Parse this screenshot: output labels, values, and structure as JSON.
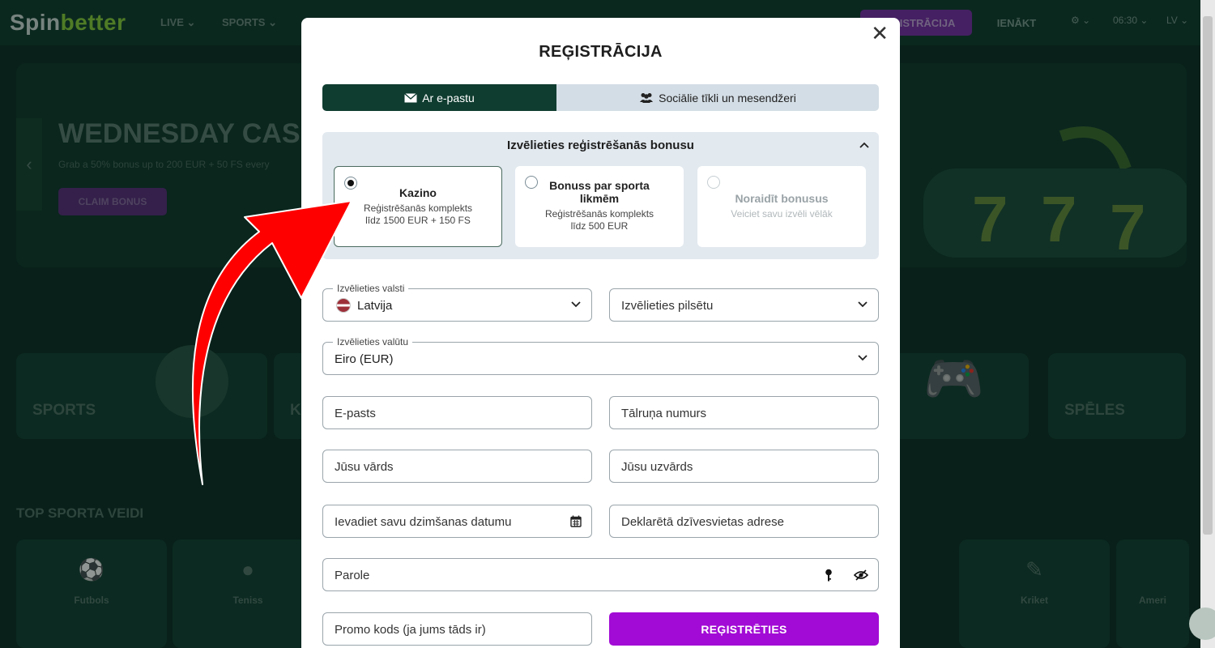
{
  "background": {
    "logo_a": "Spin",
    "logo_b": "better",
    "nav": [
      "LIVE ⌄",
      "SPORTS ⌄"
    ],
    "register_label": "REĢISTRĀCIJA",
    "login_label": "IENĀKT",
    "time": "06:30 ⌄",
    "lang": "LV ⌄",
    "banner_title": "WEDNESDAY CASI",
    "banner_sub": "Grab a 50% bonus up to 200 EUR + 50 FS every",
    "banner_btn": "CLAIM BONUS",
    "categories": [
      {
        "label": "SPORTS"
      },
      {
        "label": "K"
      },
      {
        "label": "SPĒLES"
      }
    ],
    "section_title": "TOP SPORTA VEIDI",
    "sports": [
      {
        "label": "Futbols",
        "icon": "⚽"
      },
      {
        "label": "Teniss",
        "icon": "●"
      },
      {
        "label": "Kriket",
        "icon": "✎"
      },
      {
        "label": "Kriket",
        "icon": "⚾"
      },
      {
        "label": "Ameri",
        "icon": "◎"
      }
    ]
  },
  "modal": {
    "title": "REĢISTRĀCIJA",
    "close": "✕",
    "tabs": [
      {
        "label": "Ar e-pastu",
        "icon": "envelope-icon"
      },
      {
        "label": "Sociālie tīkli un mesendžeri",
        "icon": "users-icon"
      }
    ],
    "bonus": {
      "heading": "Izvēlieties reģistrēšanās bonusu",
      "options": [
        {
          "title": "Kazino",
          "desc": "Reģistrēšanās komplekts līdz 1500 EUR + 150 FS",
          "selected": true
        },
        {
          "title": "Bonuss par sporta likmēm",
          "desc": "Reģistrēšanās komplekts līdz 500 EUR",
          "selected": false
        },
        {
          "title": "Noraidīt bonusus",
          "desc": "Veiciet savu izvēli vēlāk",
          "selected": false
        }
      ]
    },
    "country": {
      "legend": "Izvēlieties valsti",
      "value": "Latvija"
    },
    "city": {
      "placeholder": "Izvēlieties pilsētu"
    },
    "currency": {
      "legend": "Izvēlieties valūtu",
      "value": "Eiro (EUR)"
    },
    "email": {
      "placeholder": "E-pasts"
    },
    "phone": {
      "placeholder": "Tālruņa numurs"
    },
    "first_name": {
      "placeholder": "Jūsu vārds"
    },
    "last_name": {
      "placeholder": "Jūsu uzvārds"
    },
    "birthdate": {
      "placeholder": "Ievadiet savu dzimšanas datumu"
    },
    "address": {
      "placeholder": "Deklarētā dzīvesvietas adrese"
    },
    "password": {
      "placeholder": "Parole"
    },
    "promo": {
      "placeholder": "Promo kods (ja jums tāds ir)"
    },
    "submit": "REĢISTRĒTIES"
  },
  "colors": {
    "accent": "#a20bd5",
    "tab_active": "#0f3d30",
    "arrow": "#ff0000"
  }
}
